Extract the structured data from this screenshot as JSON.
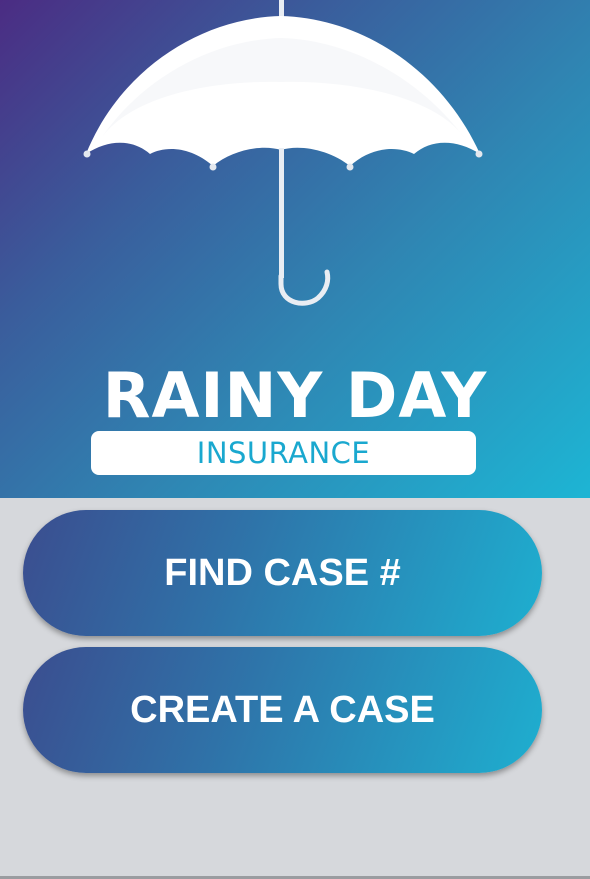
{
  "brand": {
    "name": "RAINY DAY",
    "subtitle": "INSURANCE",
    "logo_icon": "umbrella-icon"
  },
  "actions": {
    "find_case_label": "FIND CASE #",
    "create_case_label": "CREATE A CASE"
  },
  "colors": {
    "gradient_start": "#4b2c83",
    "gradient_end": "#1db5d4",
    "background": "#d6d8dc",
    "subtitle_text": "#1aa8cf"
  }
}
